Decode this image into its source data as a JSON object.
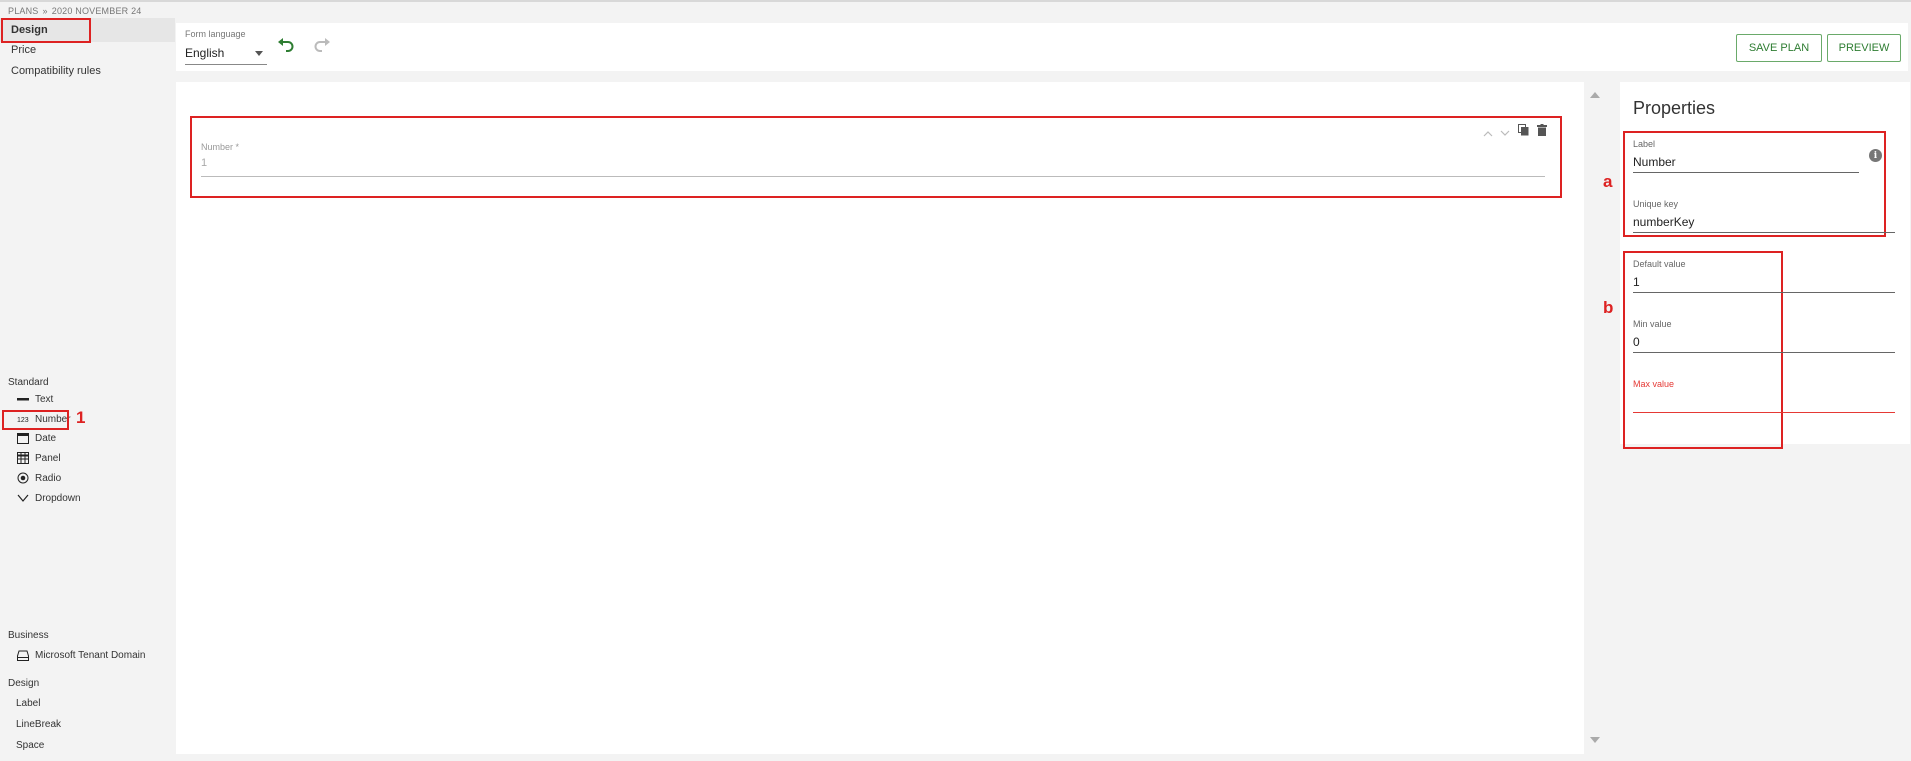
{
  "breadcrumb": {
    "root": "PLANS",
    "separator": "»",
    "current": "2020 NOVEMBER 24"
  },
  "nav": {
    "items": [
      {
        "label": "Design"
      },
      {
        "label": "Price"
      },
      {
        "label": "Compatibility rules"
      }
    ]
  },
  "toolbox": {
    "standard": {
      "title": "Standard",
      "items": [
        "Text",
        "Number",
        "Date",
        "Panel",
        "Radio",
        "Dropdown"
      ]
    },
    "business": {
      "title": "Business",
      "items": [
        "Microsoft Tenant Domain"
      ]
    },
    "design": {
      "title": "Design",
      "items": [
        "Label",
        "LineBreak",
        "Space"
      ]
    }
  },
  "toolbar": {
    "form_language_label": "Form language",
    "form_language_value": "English",
    "save_label": "SAVE PLAN",
    "preview_label": "PREVIEW"
  },
  "canvas": {
    "field": {
      "label": "Number *",
      "value": "1"
    }
  },
  "properties": {
    "title": "Properties",
    "label_caption": "Label",
    "label_value": "Number",
    "key_caption": "Unique key",
    "key_value": "numberKey",
    "default_caption": "Default value",
    "default_value": "1",
    "min_caption": "Min value",
    "min_value": "0",
    "max_caption": "Max value",
    "max_value": ""
  },
  "annotations": {
    "a": "a",
    "b": "b",
    "one": "1"
  },
  "colors": {
    "accent_green": "#2e7d32",
    "error_red": "#e53935",
    "annotation_red": "#dd2222"
  }
}
